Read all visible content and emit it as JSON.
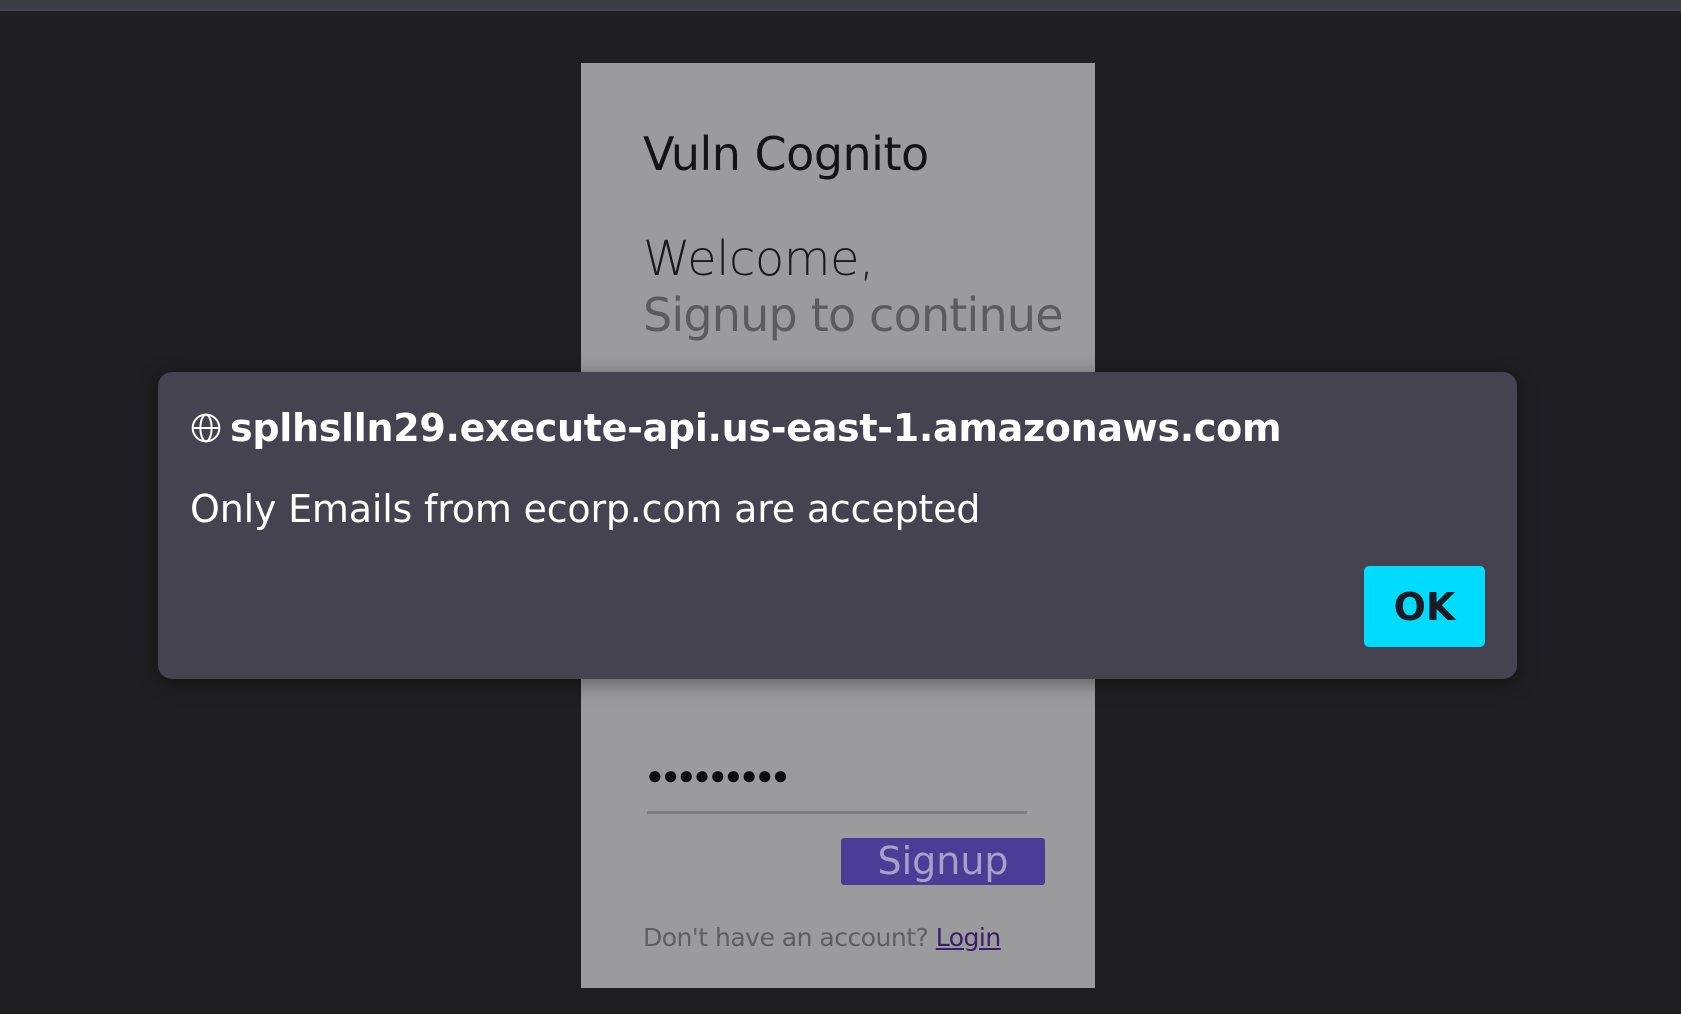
{
  "card": {
    "title": "Vuln Cognito",
    "welcome": "Welcome,",
    "subtitle": "Signup to continue",
    "password_value": "●●●●●●●●●",
    "signup_label": "Signup",
    "footer_text": "Don't have an account? ",
    "login_link": "Login"
  },
  "dialog": {
    "icon": "globe-icon",
    "origin": "splhslln29.execute-api.us-east-1.amazonaws.com",
    "message": "Only Emails from ecorp.com are accepted",
    "ok_label": "OK"
  },
  "colors": {
    "accent": "#00dcff",
    "signup_button": "#4b3d96",
    "dialog_bg": "#44434f"
  }
}
